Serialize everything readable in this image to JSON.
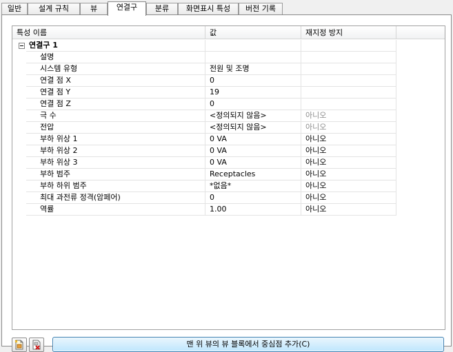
{
  "tabs": [
    "일반",
    "설계 규칙",
    "뷰",
    "연결구",
    "분류",
    "화면표시 특성",
    "버전 기록"
  ],
  "active_tab": "연결구",
  "grid": {
    "headers": [
      "특성 이름",
      "값",
      "재지정 방지"
    ],
    "category": {
      "label": "연결구 1",
      "expanded": true,
      "rows": [
        {
          "name": "설명",
          "value": "",
          "override": "",
          "greyed": false
        },
        {
          "name": "시스템 유형",
          "value": "전원 및 조명",
          "override": "",
          "greyed": false
        },
        {
          "name": "연결 점 X",
          "value": "0",
          "override": "",
          "greyed": false
        },
        {
          "name": "연결 점 Y",
          "value": "19",
          "override": "",
          "greyed": false
        },
        {
          "name": "연결 점 Z",
          "value": "0",
          "override": "",
          "greyed": false
        },
        {
          "name": "극 수",
          "value": "<정의되지 않음>",
          "override": "아니오",
          "greyed": true
        },
        {
          "name": "전압",
          "value": "<정의되지 않음>",
          "override": "아니오",
          "greyed": true
        },
        {
          "name": "부하 위상 1",
          "value": "0 VA",
          "override": "아니오",
          "greyed": false
        },
        {
          "name": "부하 위상 2",
          "value": "0 VA",
          "override": "아니오",
          "greyed": false
        },
        {
          "name": "부하 위상 3",
          "value": "0 VA",
          "override": "아니오",
          "greyed": false
        },
        {
          "name": "부하 범주",
          "value": "Receptacles",
          "override": "아니오",
          "greyed": false
        },
        {
          "name": "부하 하위 범주",
          "value": "*없음*",
          "override": "아니오",
          "greyed": false
        },
        {
          "name": "최대 과전류 정격(암페어)",
          "value": "0",
          "override": "아니오",
          "greyed": false
        },
        {
          "name": "역률",
          "value": "1.00",
          "override": "아니오",
          "greyed": false
        }
      ]
    }
  },
  "buttons": {
    "new_icon": "new-connector-icon",
    "delete_icon": "delete-connector-icon",
    "action_label": "맨 위 뷰의 뷰 블록에서 중심점 추가(C)"
  }
}
